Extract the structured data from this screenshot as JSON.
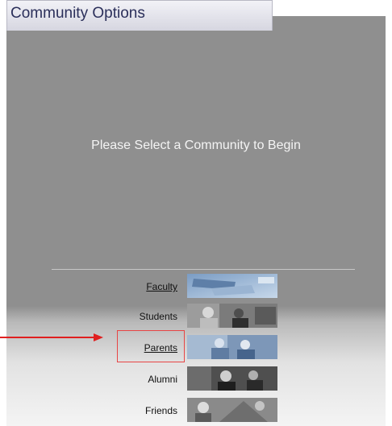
{
  "header": {
    "title": "Community Options"
  },
  "panel": {
    "prompt": "Please Select a Community to Begin"
  },
  "communities": [
    {
      "label": "Faculty",
      "link": true
    },
    {
      "label": "Students",
      "link": false
    },
    {
      "label": "Parents",
      "link": true
    },
    {
      "label": "Alumni",
      "link": false
    },
    {
      "label": "Friends",
      "link": false
    }
  ],
  "colors": {
    "header_text": "#2b2f5a",
    "annotation": "#e02020"
  }
}
